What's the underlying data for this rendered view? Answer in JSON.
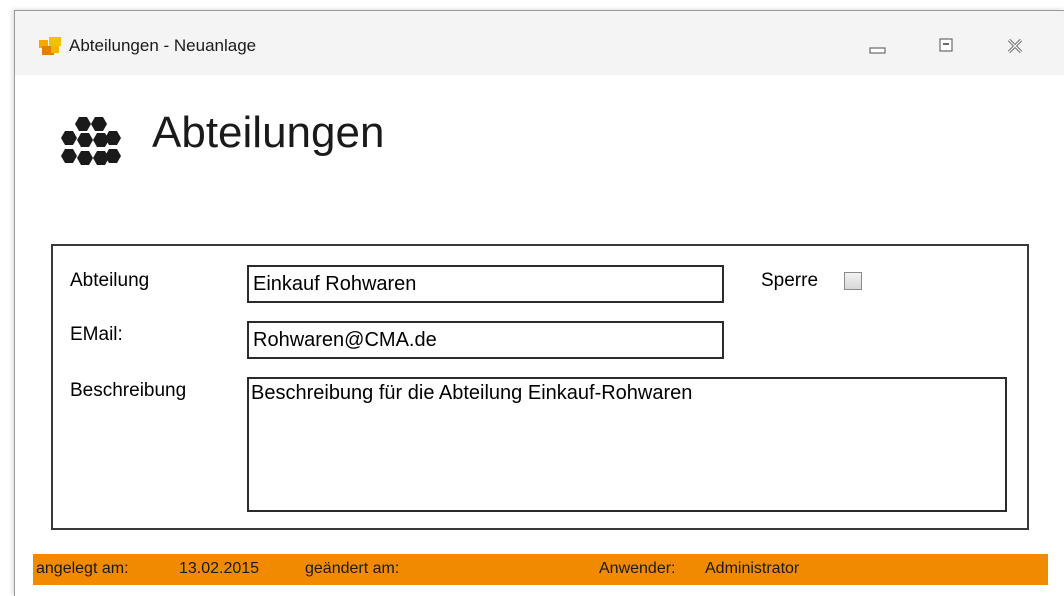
{
  "window": {
    "title": "Abteilungen - Neuanlage"
  },
  "header": {
    "title": "Abteilungen"
  },
  "form": {
    "abteilung_label": "Abteilung",
    "abteilung_value": "Einkauf Rohwaren",
    "email_label": "EMail:",
    "email_value": "Rohwaren@CMA.de",
    "beschreibung_label": "Beschreibung",
    "beschreibung_value": "Beschreibung für die Abteilung Einkauf-Rohwaren",
    "sperre_label": "Sperre",
    "sperre_checked": false
  },
  "status": {
    "created_label": "angelegt am:",
    "created_value": "13.02.2015",
    "changed_label": "geändert am:",
    "changed_value": "",
    "user_label": "Anwender:",
    "user_value": "Administrator"
  },
  "colors": {
    "status_bar": "#f28a00",
    "text": "#000000"
  },
  "icons": {
    "app": "app-icon",
    "header": "hexagon-cluster-icon",
    "minimize": "minimize-icon",
    "maximize": "maximize-icon",
    "close": "close-icon"
  }
}
